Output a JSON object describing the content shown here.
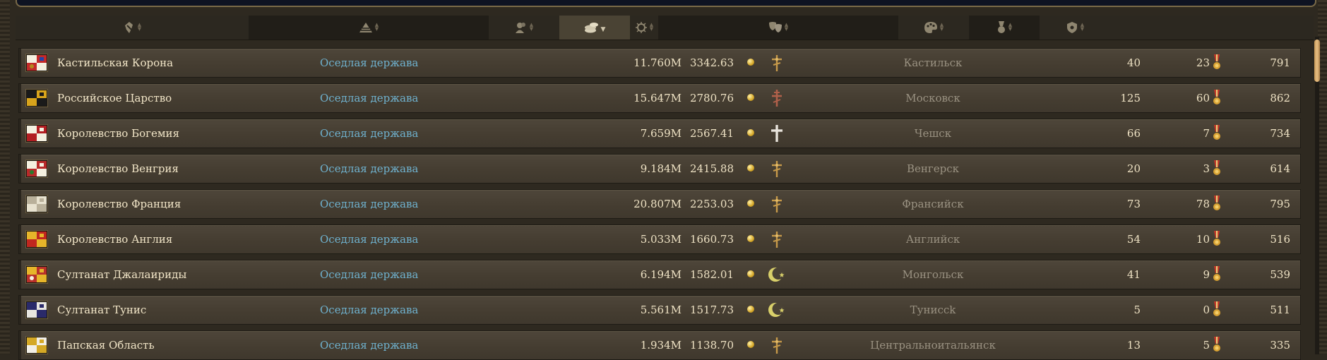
{
  "header": {
    "columns": [
      {
        "key": "realm",
        "icon": "realm-type-icon"
      },
      {
        "key": "government",
        "icon": "pyramid-icon"
      },
      {
        "key": "population",
        "icon": "population-icon"
      },
      {
        "key": "income",
        "icon": "coins-icon",
        "sorted": "desc"
      },
      {
        "key": "religion",
        "icon": "religion-icon"
      },
      {
        "key": "culture",
        "icon": "theater-masks-icon"
      },
      {
        "key": "arts",
        "icon": "palette-icon"
      },
      {
        "key": "prestige",
        "icon": "medal-icon"
      },
      {
        "key": "military",
        "icon": "shield-icon"
      }
    ]
  },
  "rows": [
    {
      "name": "Кастильская Корона",
      "government": "Оседлая держава",
      "population": "11.760M",
      "income": "3342.63",
      "religion": "cross-gold",
      "culture": "Кастильск",
      "v1": "40",
      "v2": "23",
      "v3": "791",
      "flag": {
        "colors": [
          "#c22a2a",
          "#f4f0e0",
          "#b38b1d",
          "#2244aa"
        ]
      }
    },
    {
      "name": "Российское Царство",
      "government": "Оседлая держава",
      "population": "15.647M",
      "income": "2780.76",
      "religion": "cross-orthodox",
      "culture": "Московск",
      "v1": "125",
      "v2": "60",
      "v3": "862",
      "flag": {
        "colors": [
          "#d8a41c",
          "#1a1a1a"
        ]
      }
    },
    {
      "name": "Королевство Богемия",
      "government": "Оседлая держава",
      "population": "7.659M",
      "income": "2567.41",
      "religion": "cross-white",
      "culture": "Чешск",
      "v1": "66",
      "v2": "7",
      "v3": "734",
      "flag": {
        "colors": [
          "#b21e22",
          "#f4f0e0"
        ]
      }
    },
    {
      "name": "Королевство Венгрия",
      "government": "Оседлая держава",
      "population": "9.184M",
      "income": "2415.88",
      "religion": "cross-gold",
      "culture": "Венгерск",
      "v1": "20",
      "v2": "3",
      "v3": "614",
      "flag": {
        "colors": [
          "#b82a2a",
          "#f4f0e0",
          "#2a7a2a"
        ]
      }
    },
    {
      "name": "Королевство Франция",
      "government": "Оседлая держава",
      "population": "20.807M",
      "income": "2253.03",
      "religion": "cross-gold",
      "culture": "Франсийск",
      "v1": "73",
      "v2": "78",
      "v3": "795",
      "flag": {
        "colors": [
          "#e8e2cf",
          "#b9b09a"
        ]
      }
    },
    {
      "name": "Королевство Англия",
      "government": "Оседлая держава",
      "population": "5.033M",
      "income": "1660.73",
      "religion": "cross-gold",
      "culture": "Английск",
      "v1": "54",
      "v2": "10",
      "v3": "516",
      "flag": {
        "colors": [
          "#c0271f",
          "#e6b52a"
        ]
      }
    },
    {
      "name": "Султанат Джалаириды",
      "government": "Оседлая держава",
      "population": "6.194M",
      "income": "1582.01",
      "religion": "crescent",
      "culture": "Монгольск",
      "v1": "41",
      "v2": "9",
      "v3": "539",
      "flag": {
        "colors": [
          "#b8302a",
          "#e6b52a",
          "#f4f0e0"
        ]
      }
    },
    {
      "name": "Султанат Тунис",
      "government": "Оседлая держава",
      "population": "5.561M",
      "income": "1517.73",
      "religion": "crescent",
      "culture": "Туниссk",
      "v1": "5",
      "v2": "0",
      "v3": "511",
      "flag": {
        "colors": [
          "#e8e6e0",
          "#2a2a6a"
        ]
      }
    },
    {
      "name": "Папская Область",
      "government": "Оседлая держава",
      "population": "1.934M",
      "income": "1138.70",
      "religion": "cross-gold",
      "culture": "Центральноитальянск",
      "v1": "13",
      "v2": "5",
      "v3": "335",
      "flag": {
        "colors": [
          "#f2efe6",
          "#d4a826"
        ]
      }
    }
  ]
}
